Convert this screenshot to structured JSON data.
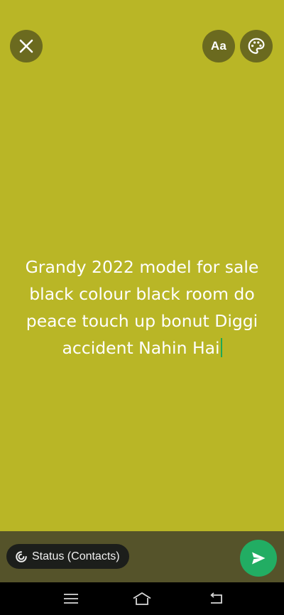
{
  "composer": {
    "text": "Grandy 2022 model for sale black colour black room do peace touch up bonut Diggi accident Nahin Hai",
    "background_color": "#b9b626",
    "cursor_color": "#1fa855"
  },
  "toolbar": {
    "close_icon": "close-icon",
    "font_label": "Aa",
    "palette_icon": "palette-icon"
  },
  "footer": {
    "audience_label": "Status (Contacts)",
    "audience_icon": "status-ring-icon",
    "send_icon": "send-icon",
    "send_color": "#22ad63"
  },
  "navigation": {
    "items": [
      "menu-icon",
      "home-icon",
      "back-icon"
    ]
  }
}
